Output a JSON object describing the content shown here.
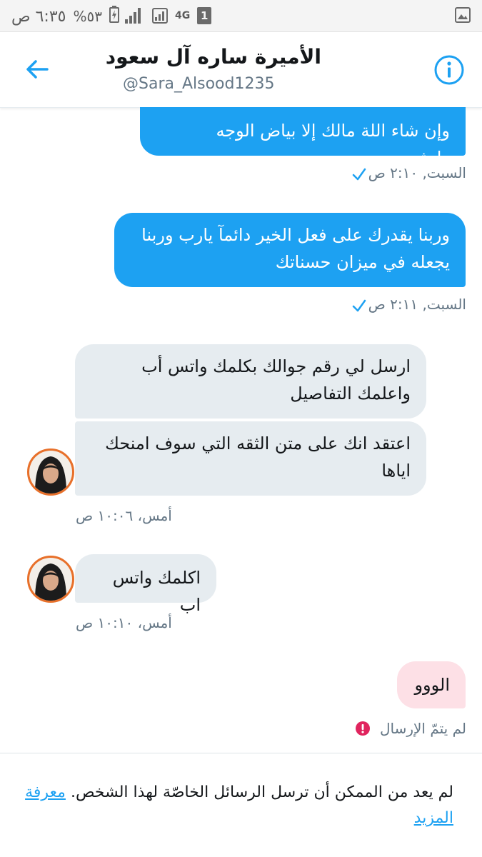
{
  "status_bar": {
    "time": "٦:٣٥ ص",
    "battery": "%٥٣",
    "network": "4G",
    "sim": "1"
  },
  "header": {
    "name": "الأميرة ساره آل سعود",
    "handle": "@Sara_Alsood1235"
  },
  "messages": [
    {
      "text": "وإن شاء اللة مالك إلا بياض الوجه وابشري",
      "meta": "السبت, ٢:١٠ ص"
    },
    {
      "text": "وربنا يقدرك على فعل الخير دائمآ  يارب وربنا يجعله في ميزان حسناتك",
      "meta": "السبت, ٢:١١ ص"
    },
    {
      "text": "ارسل لي رقم جوالك بكلمك واتس أب واعلمك التفاصيل"
    },
    {
      "text": "اعتقد انك على متن الثقه التي سوف امنحك اياها",
      "meta": "أمس، ١٠:٠٦ ص"
    },
    {
      "text": "اكلمك واتس اب",
      "meta": "أمس، ١٠:١٠ ص"
    },
    {
      "text": "الووو",
      "meta": "لم يتمّ الإرسال"
    }
  ],
  "footer": {
    "notice": "لم يعد من الممكن أن ترسل الرسائل الخاصّة لهذا الشخص.",
    "link": "معرفة المزيد"
  },
  "colors": {
    "accent": "#1da1f2",
    "incoming_bubble": "#e6ecf0",
    "failed_bubble": "#fde0e6",
    "error": "#e0245e",
    "avatar_ring": "#e8702a"
  }
}
